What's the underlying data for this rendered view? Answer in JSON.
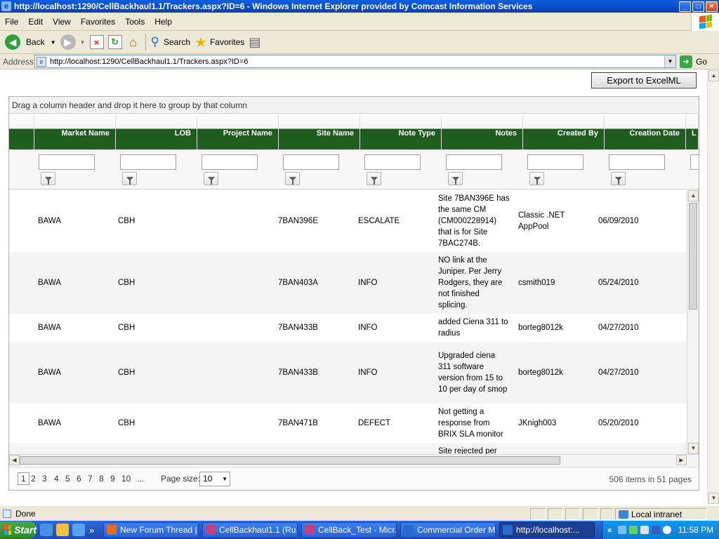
{
  "window": {
    "title": "http://localhost:1290/CellBackhaul1.1/Trackers.aspx?ID=6 - Windows Internet Explorer provided by Comcast Information Services"
  },
  "menu": [
    "File",
    "Edit",
    "View",
    "Favorites",
    "Tools",
    "Help"
  ],
  "toolbar": {
    "back": "Back",
    "search": "Search",
    "favorites": "Favorites"
  },
  "address": {
    "label": "Address",
    "url": "http://localhost:1290/CellBackhaul1.1/Trackers.aspx?ID=6",
    "go": "Go"
  },
  "export_label": "Export to ExcelML",
  "grid": {
    "group_hint": "Drag a column header and drop it here to group by that column",
    "columns": [
      "Market Name",
      "LOB",
      "Project Name",
      "Site Name",
      "Note Type",
      "Notes",
      "Created By",
      "Creation Date",
      "L"
    ],
    "rows": [
      {
        "market": "BAWA",
        "lob": "CBH",
        "project": "",
        "site": "7BAN396E",
        "type": "ESCALATE",
        "notes": "Site 7BAN396E has the same CM (CM000228914) that is for Site 7BAC274B.",
        "created_by": "Classic .NET AppPool",
        "date": "06/09/2010"
      },
      {
        "market": "BAWA",
        "lob": "CBH",
        "project": "",
        "site": "7BAN403A",
        "type": "INFO",
        "notes": "NO link at the Juniper. Per Jerry Rodgers, they are not finished splicing.",
        "created_by": "csmith019",
        "date": "05/24/2010"
      },
      {
        "market": "BAWA",
        "lob": "CBH",
        "project": "",
        "site": "7BAN433B",
        "type": "INFO",
        "notes": "added Ciena 311 to radius",
        "created_by": "borteg8012k",
        "date": "04/27/2010"
      },
      {
        "market": "BAWA",
        "lob": "CBH",
        "project": "",
        "site": "7BAN433B",
        "type": "INFO",
        "notes": "Upgraded ciena 311 software version from 15 to 10 per day of smop",
        "created_by": "borteg8012k",
        "date": "04/27/2010"
      },
      {
        "market": "BAWA",
        "lob": "CBH",
        "project": "",
        "site": "7BAN471B",
        "type": "DEFECT",
        "notes": "Not getting a response from BRIX SLA monitor",
        "created_by": "JKnigh003",
        "date": "05/20/2010"
      },
      {
        "market": "",
        "lob": "",
        "project": "",
        "site": "",
        "type": "",
        "notes": "Site rejected per",
        "created_by": "",
        "date": ""
      }
    ],
    "pager": {
      "pages": [
        "1",
        "2",
        "3",
        "4",
        "5",
        "6",
        "7",
        "8",
        "9",
        "10",
        "..."
      ],
      "current": "1",
      "page_size_label": "Page size:",
      "page_size": "10",
      "total_items": "506",
      "items_in_label": "items in",
      "total_pages": "51",
      "pages_label": "pages"
    }
  },
  "status": {
    "text": "Done",
    "zone": "Local intranet"
  },
  "taskbar": {
    "start": "Start",
    "overflow": "»",
    "tasks": [
      "New Forum Thread |...",
      "CellBackhaul1.1 (Ru...",
      "CellBack_Test - Micr...",
      "Commercial Order Ma...",
      "http://localhost:..."
    ],
    "tray_arrow": "«",
    "clock": "11:58 PM"
  }
}
